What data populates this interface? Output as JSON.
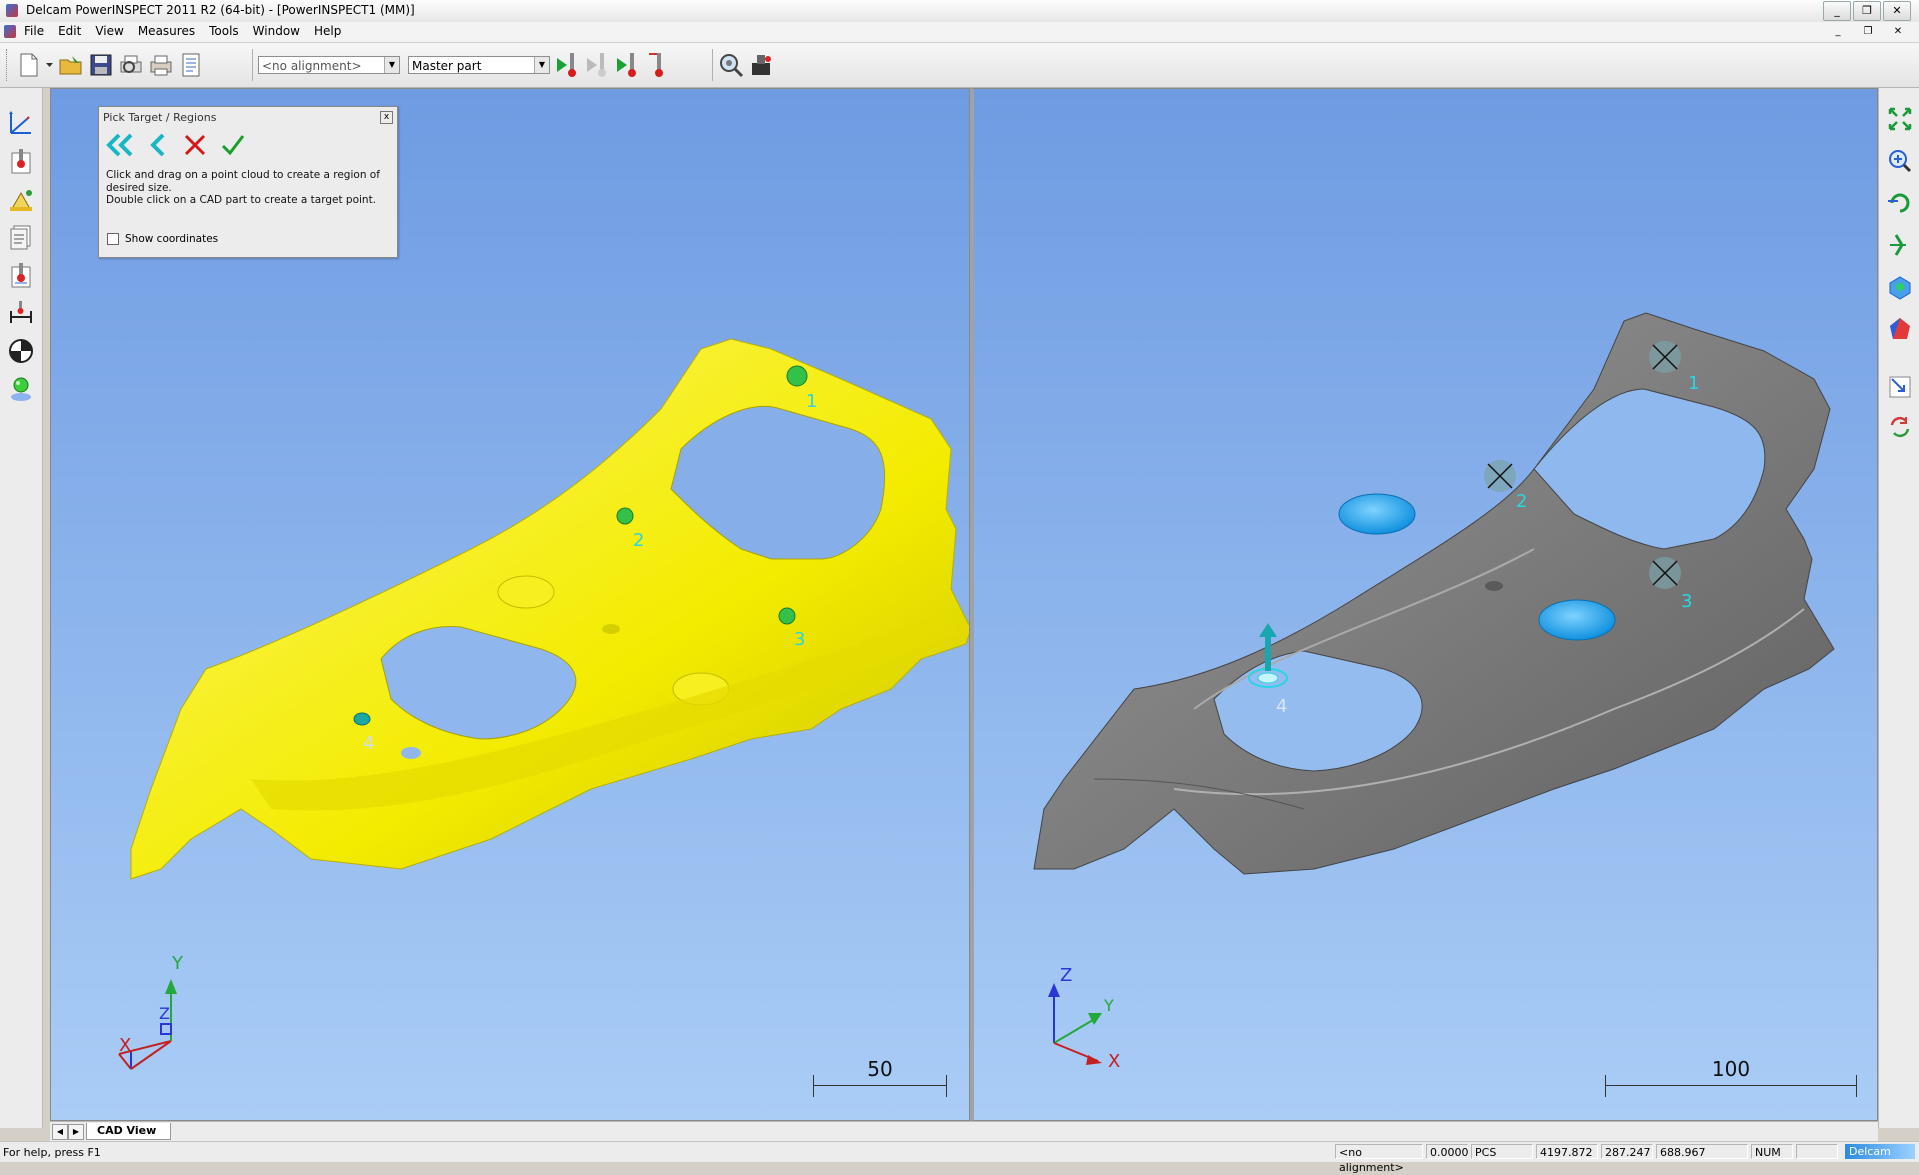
{
  "window": {
    "title": "Delcam PowerINSPECT 2011 R2 (64-bit) - [PowerINSPECT1 (MM)]",
    "minimize": "_",
    "restore": "❐",
    "close": "✕"
  },
  "menu": {
    "items": [
      "File",
      "Edit",
      "View",
      "Measures",
      "Tools",
      "Window",
      "Help"
    ]
  },
  "toolbar": {
    "alignment_select": "<no alignment>",
    "part_select": "Master part"
  },
  "pick_panel": {
    "title": "Pick Target / Regions",
    "instructions_line1": "Click and drag on a point cloud to create a region of desired size.",
    "instructions_line2": "Double click on a CAD part to create a target point.",
    "show_coordinates": "Show coordinates"
  },
  "left_view": {
    "labels": [
      "1",
      "2",
      "3",
      "4"
    ],
    "scale": "50",
    "axes": {
      "x": "X",
      "y": "Y",
      "z": "Z"
    }
  },
  "right_view": {
    "labels": [
      "1",
      "2",
      "3",
      "4"
    ],
    "scale": "100",
    "axes": {
      "x": "X",
      "y": "Y",
      "z": "Z"
    }
  },
  "tabs": {
    "active": "CAD View"
  },
  "status": {
    "help": "For help, press F1",
    "alignment": "<no alignment>",
    "value": "0.0000",
    "cs": "PCS",
    "x": "4197.872",
    "y": "287.247",
    "z": "688.967",
    "num": "NUM",
    "brand": "Delcam"
  },
  "colors": {
    "viewport_top": "#6e9be2",
    "viewport_bottom": "#aacdf6",
    "point_cloud": "#f5f000",
    "cad_part": "#777777",
    "target_fill": "#1aa3ea",
    "label": "#28d7e2"
  }
}
